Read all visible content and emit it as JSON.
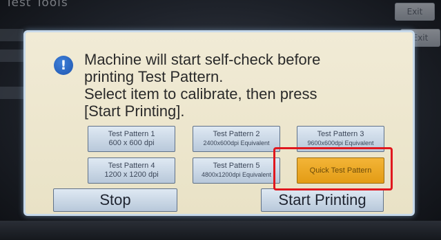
{
  "screen": {
    "background_title": "Test Tools",
    "background_exit_label": "Exit"
  },
  "dialog": {
    "message_lines": [
      "Machine will start self-check before",
      "printing Test Pattern.",
      "Select item to calibrate, then press",
      "[Start Printing]."
    ],
    "icon": "info-icon",
    "options": [
      {
        "line1": "Test Pattern 1",
        "line2": "600 x 600 dpi"
      },
      {
        "line1": "Test Pattern 2",
        "line2": "2400x600dpi Equivalent"
      },
      {
        "line1": "Test Pattern 3",
        "line2": "9600x600dpi Equivalent"
      },
      {
        "line1": "Test Pattern 4",
        "line2": "1200 x 1200 dpi"
      },
      {
        "line1": "Test Pattern 5",
        "line2": "4800x1200dpi Equivalent"
      },
      {
        "line1": "Quick Test Pattern",
        "line2": ""
      }
    ],
    "selected_option": "Quick Test Pattern",
    "stop_label": "Stop",
    "start_label": "Start Printing"
  },
  "colors": {
    "dialog_bg": "#ede6cc",
    "button_blue": "#c9d7e6",
    "selected_orange": "#eca82a",
    "highlight_red": "#e0171e",
    "info_blue": "#2a64c4"
  }
}
